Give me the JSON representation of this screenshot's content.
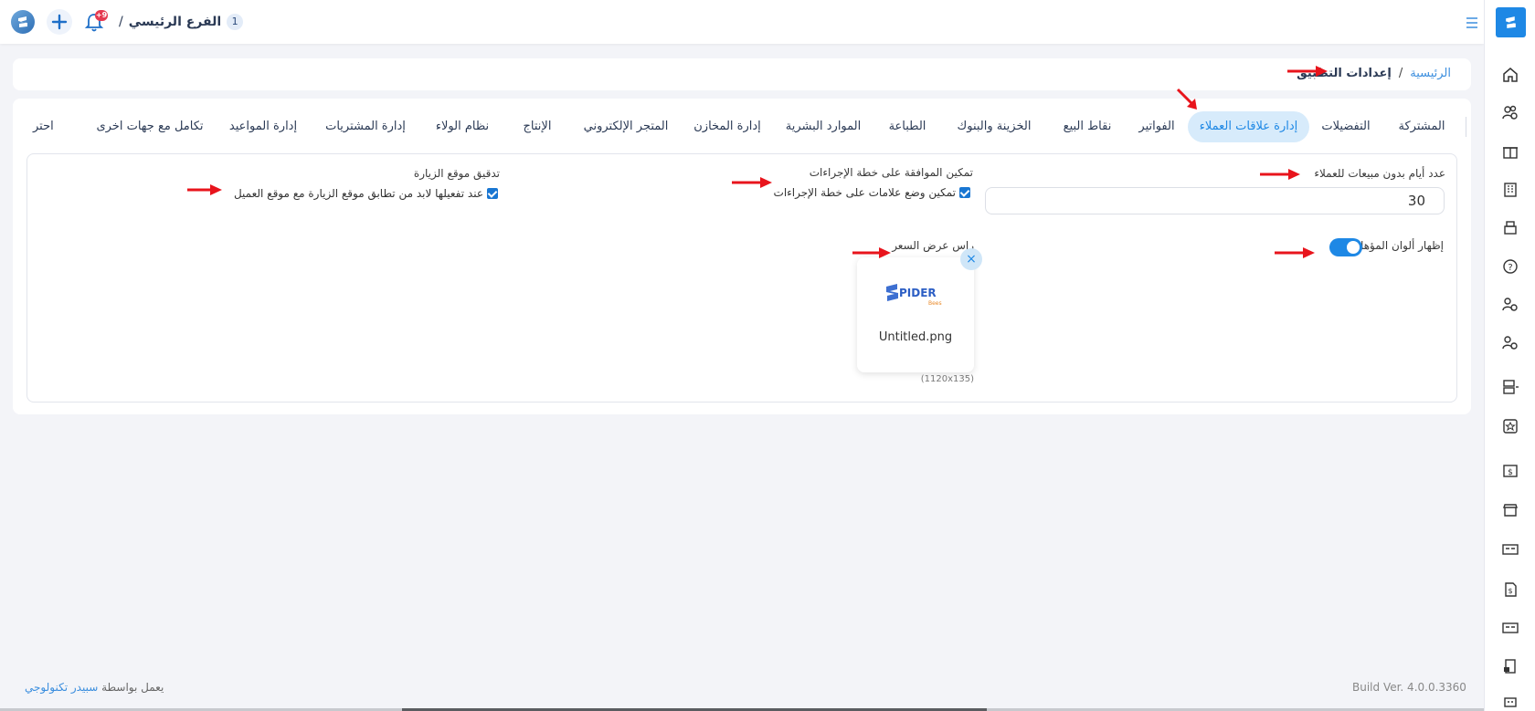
{
  "header": {
    "branch_number": "1",
    "branch_name": "الفرع الرئيسي",
    "branch_separator": "/",
    "notification_count": "+9"
  },
  "breadcrumb": {
    "home": "الرئيسية",
    "separator": "/",
    "current": "إعدادات التطبيق"
  },
  "tabs": [
    {
      "label": "المشتركة",
      "active": false
    },
    {
      "label": "التفضيلات",
      "active": false
    },
    {
      "label": "إدارة علاقات العملاء",
      "active": true
    },
    {
      "label": "الفواتير",
      "active": false
    },
    {
      "label": "نقاط البيع",
      "active": false
    },
    {
      "label": "الخزينة والبنوك",
      "active": false
    },
    {
      "label": "الطباعة",
      "active": false
    },
    {
      "label": "الموارد البشرية",
      "active": false
    },
    {
      "label": "إدارة المخازن",
      "active": false
    },
    {
      "label": "المتجر الإلكتروني",
      "active": false
    },
    {
      "label": "الإنتاج",
      "active": false
    },
    {
      "label": "نظام الولاء",
      "active": false
    },
    {
      "label": "إدارة المشتريات",
      "active": false
    },
    {
      "label": "إدارة المواعيد",
      "active": false
    },
    {
      "label": "تكامل مع جهات اخرى",
      "active": false
    },
    {
      "label": "احتر",
      "active": false
    }
  ],
  "settings": {
    "days_without_sales_label": "عدد أيام بدون مبيعات للعملاء",
    "days_without_sales_value": "30",
    "plan_approval_label": "تمكين الموافقة على خطة الإجراءات",
    "plan_marks_checkbox": "تمكين وضع علامات على خطة الإجراءات",
    "visit_location_label": "تدقيق موقع الزيارة",
    "visit_location_checkbox": "عند تفعيلها لابد من تطابق موقع الزيارة مع موقع العميل",
    "qualified_colors_label": "إظهار ألوان المؤهل",
    "qualified_colors_on": true,
    "quote_header_label": "راس عرض السعر"
  },
  "file": {
    "name": "Untitled.png",
    "dimensions": "(1120x135)",
    "remove_symbol": "×",
    "logo_text": "PIDER",
    "logo_sub": "Bees"
  },
  "footer": {
    "powered_by": "يعمل بواسطة",
    "company": "سبيدر تكنولوجي",
    "build": "Build Ver. 4.0.0.3360"
  },
  "colors": {
    "accent": "#1e88e5",
    "active_tab_bg": "#d7ebfb",
    "arrow": "#e8141c"
  }
}
